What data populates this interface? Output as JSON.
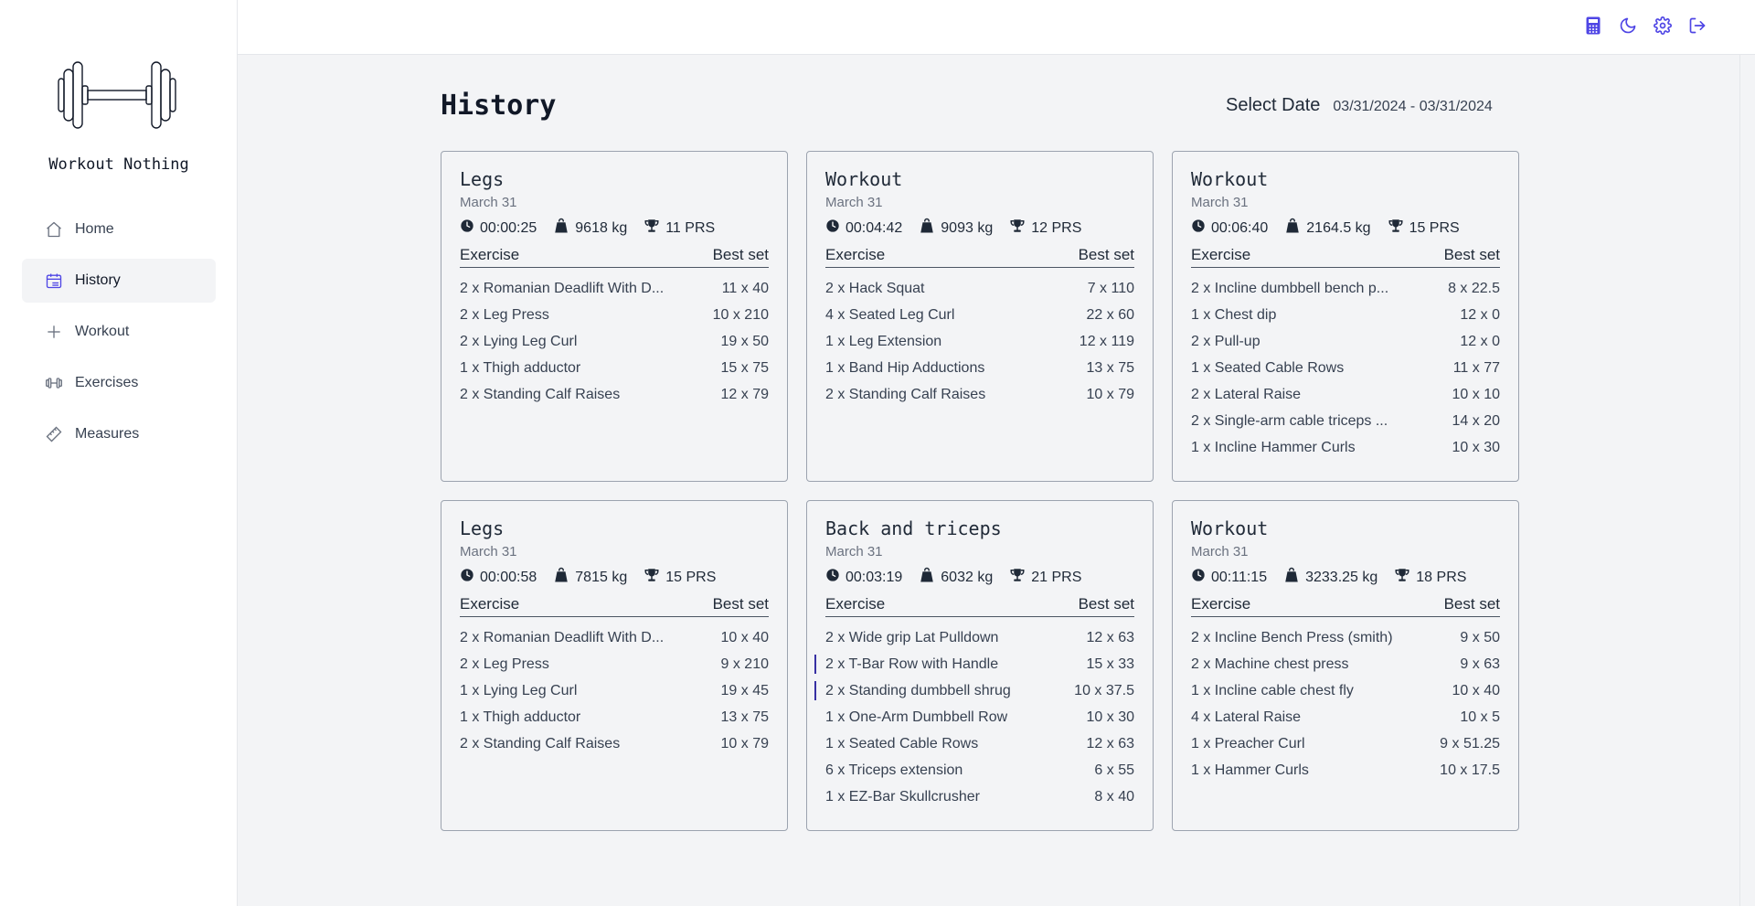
{
  "app": {
    "name": "Workout Nothing"
  },
  "nav": [
    {
      "label": "Home",
      "icon": "home-icon",
      "active": false
    },
    {
      "label": "History",
      "icon": "calendar-icon",
      "active": true
    },
    {
      "label": "Workout",
      "icon": "plus-icon",
      "active": false
    },
    {
      "label": "Exercises",
      "icon": "dumbbell-icon",
      "active": false
    },
    {
      "label": "Measures",
      "icon": "ruler-icon",
      "active": false
    }
  ],
  "topbar": {
    "icons": [
      "calculator-icon",
      "moon-icon",
      "gear-icon",
      "logout-icon"
    ],
    "accent": "#4f46e5"
  },
  "page": {
    "title": "History",
    "select_date_label": "Select Date",
    "date_range": "03/31/2024 - 03/31/2024"
  },
  "table_headers": {
    "exercise": "Exercise",
    "best_set": "Best set"
  },
  "cards": [
    {
      "title": "Legs",
      "date": "March 31",
      "duration": "00:00:25",
      "volume": "9618 kg",
      "prs": "11 PRS",
      "rows": [
        {
          "name": "2 x Romanian Deadlift With D...",
          "best": "11 x 40"
        },
        {
          "name": "2 x Leg Press",
          "best": "10 x 210"
        },
        {
          "name": "2 x Lying Leg Curl",
          "best": "19 x 50"
        },
        {
          "name": "1 x Thigh adductor",
          "best": "15 x 75"
        },
        {
          "name": "2 x Standing Calf Raises",
          "best": "12 x 79"
        }
      ]
    },
    {
      "title": "Workout",
      "date": "March 31",
      "duration": "00:04:42",
      "volume": "9093 kg",
      "prs": "12 PRS",
      "rows": [
        {
          "name": "2 x Hack Squat",
          "best": "7 x 110"
        },
        {
          "name": "4 x Seated Leg Curl",
          "best": "22 x 60"
        },
        {
          "name": "1 x Leg Extension",
          "best": "12 x 119"
        },
        {
          "name": "1 x Band Hip Adductions",
          "best": "13 x 75"
        },
        {
          "name": "2 x Standing Calf Raises",
          "best": "10 x 79"
        }
      ]
    },
    {
      "title": "Workout",
      "date": "March 31",
      "duration": "00:06:40",
      "volume": "2164.5 kg",
      "prs": "15 PRS",
      "rows": [
        {
          "name": "2 x Incline dumbbell bench p...",
          "best": "8 x 22.5"
        },
        {
          "name": "1 x Chest dip",
          "best": "12 x 0"
        },
        {
          "name": "2 x Pull-up",
          "best": "12 x 0"
        },
        {
          "name": "1 x Seated Cable Rows",
          "best": "11 x 77"
        },
        {
          "name": "2 x Lateral Raise",
          "best": "10 x 10"
        },
        {
          "name": "2 x Single-arm cable triceps ...",
          "best": "14 x 20"
        },
        {
          "name": "1 x Incline Hammer Curls",
          "best": "10 x 30"
        }
      ]
    },
    {
      "title": "Legs",
      "date": "March 31",
      "duration": "00:00:58",
      "volume": "7815 kg",
      "prs": "15 PRS",
      "rows": [
        {
          "name": "2 x Romanian Deadlift With D...",
          "best": "10 x 40"
        },
        {
          "name": "2 x Leg Press",
          "best": "9 x 210"
        },
        {
          "name": "1 x Lying Leg Curl",
          "best": "19 x 45"
        },
        {
          "name": "1 x Thigh adductor",
          "best": "13 x 75"
        },
        {
          "name": "2 x Standing Calf Raises",
          "best": "10 x 79"
        }
      ]
    },
    {
      "title": "Back and triceps",
      "date": "March 31",
      "duration": "00:03:19",
      "volume": "6032 kg",
      "prs": "21 PRS",
      "rows": [
        {
          "name": "2 x Wide grip Lat Pulldown",
          "best": "12 x 63"
        },
        {
          "name": "2 x T-Bar Row with Handle",
          "best": "15 x 33",
          "marked": true
        },
        {
          "name": "2 x Standing dumbbell shrug",
          "best": "10 x 37.5",
          "marked": true
        },
        {
          "name": "1 x One-Arm Dumbbell Row",
          "best": "10 x 30"
        },
        {
          "name": "1 x Seated Cable Rows",
          "best": "12 x 63"
        },
        {
          "name": "6 x Triceps extension",
          "best": "6 x 55"
        },
        {
          "name": "1 x EZ-Bar Skullcrusher",
          "best": "8 x 40"
        }
      ]
    },
    {
      "title": "Workout",
      "date": "March 31",
      "duration": "00:11:15",
      "volume": "3233.25 kg",
      "prs": "18 PRS",
      "rows": [
        {
          "name": "2 x Incline Bench Press (smith)",
          "best": "9 x 50"
        },
        {
          "name": "2 x Machine chest press",
          "best": "9 x 63"
        },
        {
          "name": "1 x Incline cable chest fly",
          "best": "10 x 40"
        },
        {
          "name": "4 x Lateral Raise",
          "best": "10 x 5"
        },
        {
          "name": "1 x Preacher Curl",
          "best": "9 x 51.25"
        },
        {
          "name": "1 x Hammer Curls",
          "best": "10 x 17.5"
        }
      ]
    }
  ]
}
